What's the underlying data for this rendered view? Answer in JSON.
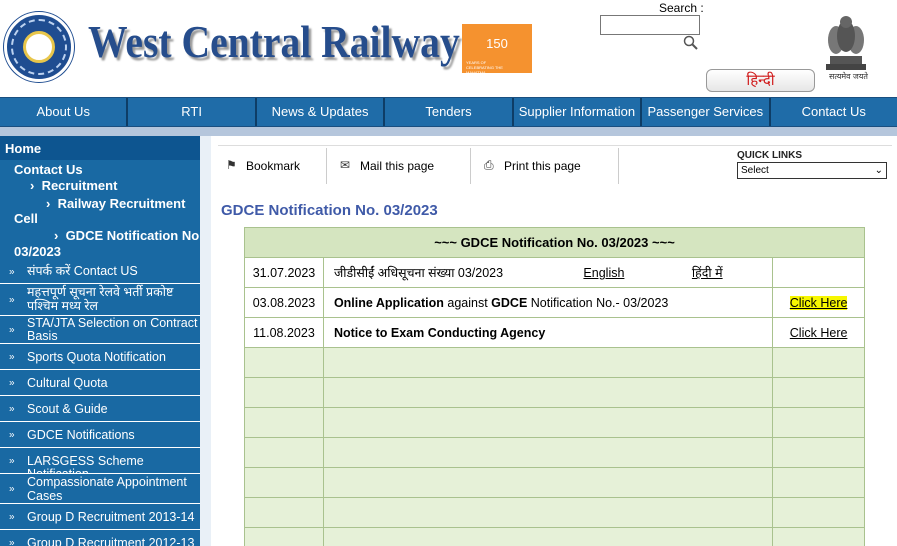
{
  "header": {
    "site_title": "West Central Railway",
    "logo_ring_text": "भारतीय रेल • INDIAN RAILWAYS",
    "badge_number": "150",
    "badge_caption": "YEARS OF CELEBRATING THE MAHATMA",
    "search_label": "Search :",
    "search_placeholder": "",
    "hindi_button": "हिन्दी",
    "emblem_caption": "सत्यमेव जयते"
  },
  "nav": {
    "items": [
      "About Us",
      "RTI",
      "News & Updates",
      "Tenders",
      "Supplier Information",
      "Passenger Services",
      "Contact Us"
    ]
  },
  "sidebar": {
    "home": "Home",
    "tree": {
      "contact_us": "Contact Us",
      "recruitment": "Recruitment",
      "railway_recruitment_cell_1": "Railway Recruitment",
      "railway_recruitment_cell_2": "Cell",
      "gdce_notification_1": "GDCE Notification No.",
      "gdce_notification_2": "03/2023"
    },
    "items": [
      {
        "label_1": "संपर्क करें Contact US",
        "label_2": ""
      },
      {
        "label_1": "महत्तपूर्ण सूचना रेलवे भर्ती प्रकोष्ट",
        "label_2": "पश्चिम मध्य रेल"
      },
      {
        "label_1": "STA/JTA Selection on Contract",
        "label_2": "Basis"
      },
      {
        "label_1": "Sports Quota Notification",
        "label_2": ""
      },
      {
        "label_1": "Cultural Quota",
        "label_2": ""
      },
      {
        "label_1": "Scout & Guide",
        "label_2": ""
      },
      {
        "label_1": "GDCE Notifications",
        "label_2": ""
      },
      {
        "label_1": "LARSGESS Scheme Notification",
        "label_2": ""
      },
      {
        "label_1": "Compassionate Appointment",
        "label_2": "Cases"
      },
      {
        "label_1": "Group D Recruitment 2013-14",
        "label_2": ""
      },
      {
        "label_1": "Group D Recruitment 2012-13",
        "label_2": ""
      }
    ]
  },
  "toolbar": {
    "bookmark": "Bookmark",
    "mail": "Mail this page",
    "print": "Print this page",
    "quick_links_label": "QUICK LINKS",
    "quick_links_selected": "Select"
  },
  "main": {
    "page_title": "GDCE Notification No. 03/2023",
    "table_title": "~~~ GDCE Notification No. 03/2023 ~~~",
    "rows": [
      {
        "date": "31.07.2023",
        "desc_hindi": "जीडीसीईं अधिसूचना संख्या  03/2023",
        "english_link": "English",
        "hindi_link": "हिंदी में",
        "link": ""
      },
      {
        "date": "03.08.2023",
        "desc_b1": "Online Application",
        "desc_t1": " against ",
        "desc_b2": "GDCE",
        "desc_t2": " Notification No.- 03/2023",
        "link": "Click Here"
      },
      {
        "date": "11.08.2023",
        "desc_bold": "Notice to Exam Conducting Agency",
        "link": "Click Here"
      }
    ]
  },
  "colors": {
    "nav_blue": "#1f6ca8",
    "sidebar_blue": "#1969a3",
    "title_blue": "#264d8c",
    "table_header_green": "#d5e5c0",
    "table_empty_green": "#e6f1d8",
    "highlight_yellow": "#f7f700",
    "hindi_red": "#d01b1b",
    "badge_orange": "#f5922f"
  }
}
